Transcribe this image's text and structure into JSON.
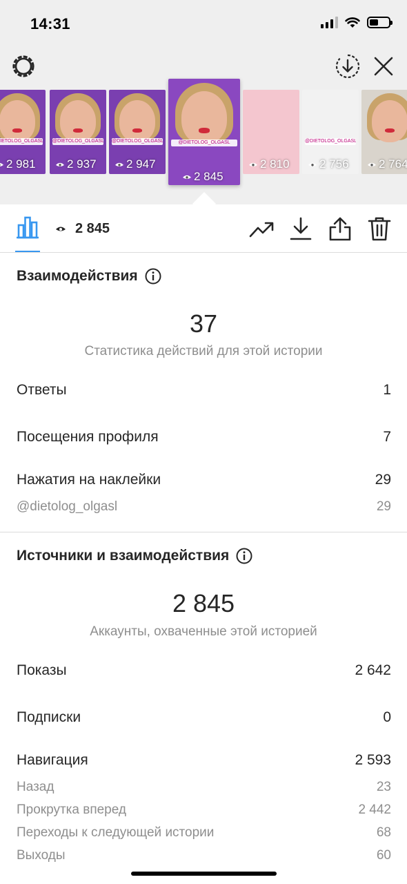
{
  "status_bar": {
    "time": "14:31"
  },
  "story_thumbnails": [
    {
      "views": "2 981",
      "tag": "@DIETOLOG_OLGASL",
      "bg": "#7a3fb0"
    },
    {
      "views": "2 937",
      "tag": "@DIETOLOG_OLGASL",
      "bg": "#7a3fb0"
    },
    {
      "views": "2 947",
      "tag": "@DIETOLOG_OLGASL",
      "bg": "#7a3fb0"
    },
    {
      "views": "2 845",
      "tag": "@DIETOLOG_OLGASL",
      "bg": "#8a48c0",
      "selected": true
    },
    {
      "views": "2 810",
      "tag": "",
      "bg": "#f4c6cf"
    },
    {
      "views": "2 756",
      "tag": "@DIETOLOG_OLGASL",
      "bg": "#f2f2f2"
    },
    {
      "views": "2 764",
      "tag": "",
      "bg": "#d9d4cc"
    }
  ],
  "tabbar": {
    "reach_count": "2 845"
  },
  "interactions": {
    "title": "Взаимодействия",
    "total": "37",
    "subtitle": "Статистика действий для этой истории",
    "rows": [
      {
        "label": "Ответы",
        "value": "1"
      },
      {
        "label": "Посещения профиля",
        "value": "7"
      },
      {
        "label": "Нажатия на наклейки",
        "value": "29"
      }
    ],
    "sticker_rows": [
      {
        "label": "@dietolog_olgasl",
        "value": "29"
      }
    ]
  },
  "discovery": {
    "title": "Источники и взаимодействия",
    "total": "2 845",
    "subtitle": "Аккаунты, охваченные этой историей",
    "rows": [
      {
        "label": "Показы",
        "value": "2 642"
      },
      {
        "label": "Подписки",
        "value": "0"
      },
      {
        "label": "Навигация",
        "value": "2 593"
      }
    ],
    "navigation_rows": [
      {
        "label": "Назад",
        "value": "23"
      },
      {
        "label": "Прокрутка вперед",
        "value": "2 442"
      },
      {
        "label": "Переходы к следующей истории",
        "value": "68"
      },
      {
        "label": "Выходы",
        "value": "60"
      }
    ]
  },
  "colors": {
    "accent": "#3897f0",
    "text": "#262626",
    "muted": "#8e8e8e",
    "divider": "#dbdbdb",
    "header_bg": "#efefef"
  }
}
